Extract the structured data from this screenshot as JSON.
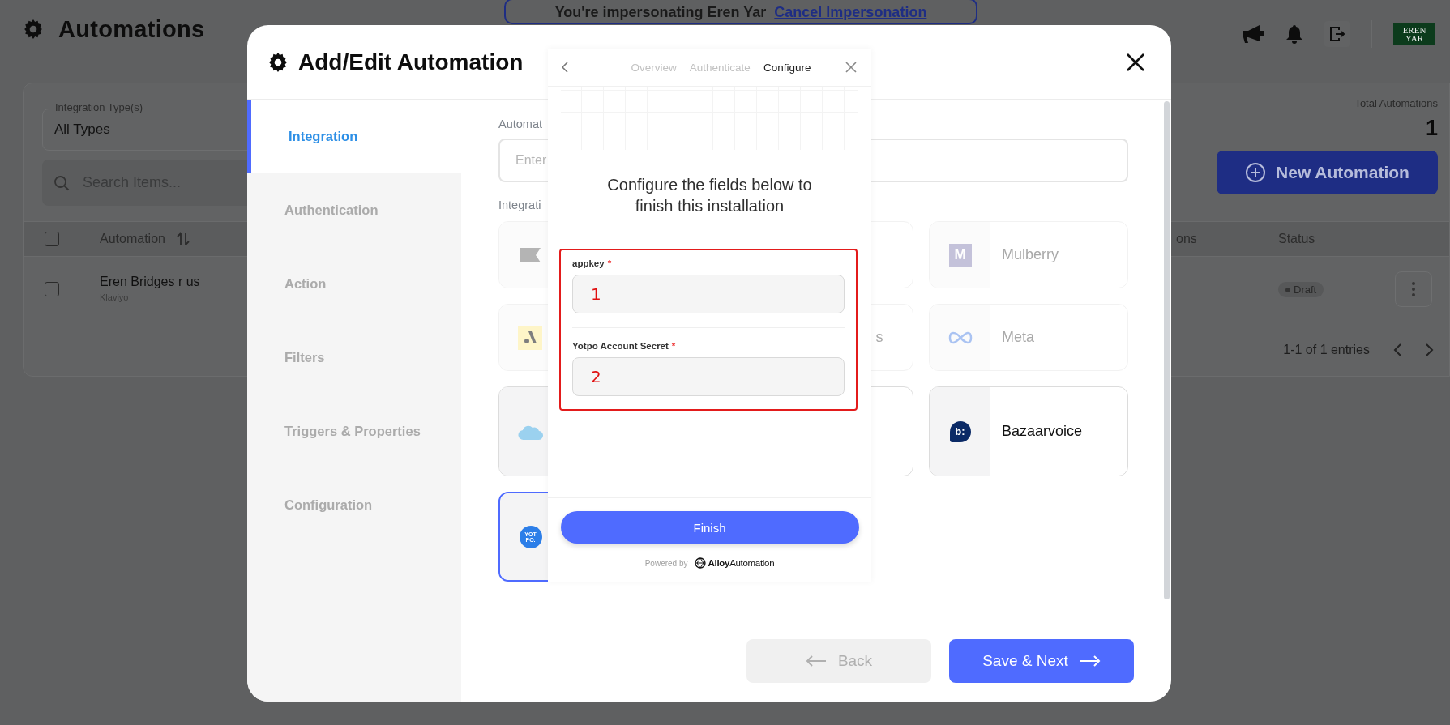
{
  "page": {
    "title": "Automations",
    "banner": {
      "text": "You're impersonating Eren Yar",
      "link": "Cancel Impersonation"
    },
    "avatar_text": "EREN YAR"
  },
  "filters": {
    "integration_type": {
      "label": "Integration Type(s)",
      "value": "All Types"
    },
    "search": {
      "placeholder": "Search Items..."
    }
  },
  "totals": {
    "label": "Total Automations",
    "value": "1"
  },
  "new_button": "New Automation",
  "table": {
    "header_checked": false,
    "columns": [
      {
        "label": "Automation",
        "sortable": true
      },
      {
        "label": "ons",
        "sortable": false
      },
      {
        "label": "Status",
        "sortable": false
      }
    ],
    "rows": [
      {
        "name": "Eren Bridges r us",
        "integration": "Klaviyo",
        "status": "Draft",
        "checked": false
      }
    ]
  },
  "pagination": {
    "text": "1-1 of 1 entries"
  },
  "modal": {
    "title": "Add/Edit Automation",
    "steps": [
      {
        "label": "Integration",
        "selected": true,
        "disabled": false
      },
      {
        "label": "Authentication",
        "selected": false,
        "disabled": true
      },
      {
        "label": "Action",
        "selected": false,
        "disabled": true
      },
      {
        "label": "Filters",
        "selected": false,
        "disabled": true
      },
      {
        "label": "Triggers & Properties",
        "selected": false,
        "disabled": true
      },
      {
        "label": "Configuration",
        "selected": false,
        "disabled": true
      }
    ],
    "automation_label": "Automat",
    "name_placeholder": "Enter",
    "integration_label": "Integrati",
    "cards": [
      {
        "kind": "flag",
        "disabled": true,
        "selected": false
      },
      {
        "disabled": true,
        "selected": false
      },
      {
        "kind": "mulberry",
        "icon_text": "M",
        "name": "Mulberry",
        "disabled": true,
        "selected": false
      },
      {
        "kind": "a-logo",
        "disabled": true,
        "selected": false
      },
      {
        "name": "s",
        "disabled": true,
        "selected": false
      },
      {
        "kind": "meta",
        "name": "Meta",
        "disabled": true,
        "selected": false
      },
      {
        "kind": "cloud",
        "disabled": false,
        "selected": false
      },
      {
        "disabled": false,
        "selected": false
      },
      {
        "kind": "bazaarvoice",
        "icon_text": "b:",
        "name": "Bazaarvoice",
        "disabled": false,
        "selected": false
      },
      {
        "kind": "yotpo",
        "icon_text": "YOT PO.",
        "disabled": false,
        "selected": true
      }
    ],
    "back": {
      "label": "Back",
      "disabled": true
    },
    "next": {
      "label": "Save & Next"
    }
  },
  "popup": {
    "tabs": [
      {
        "label": "Overview",
        "selected": false
      },
      {
        "label": "Authenticate",
        "selected": false
      },
      {
        "label": "Configure",
        "selected": true
      }
    ],
    "heading": "Configure the fields below to finish this installation",
    "highlight": true,
    "fields": [
      {
        "label": "appkey",
        "required_mark": "*",
        "mark": "1"
      },
      {
        "label": "Yotpo Account Secret",
        "required_mark": "*",
        "mark": "2"
      }
    ],
    "finish": "Finish",
    "powered_by": "Powered by",
    "brand": "**Alloy**Automation"
  }
}
